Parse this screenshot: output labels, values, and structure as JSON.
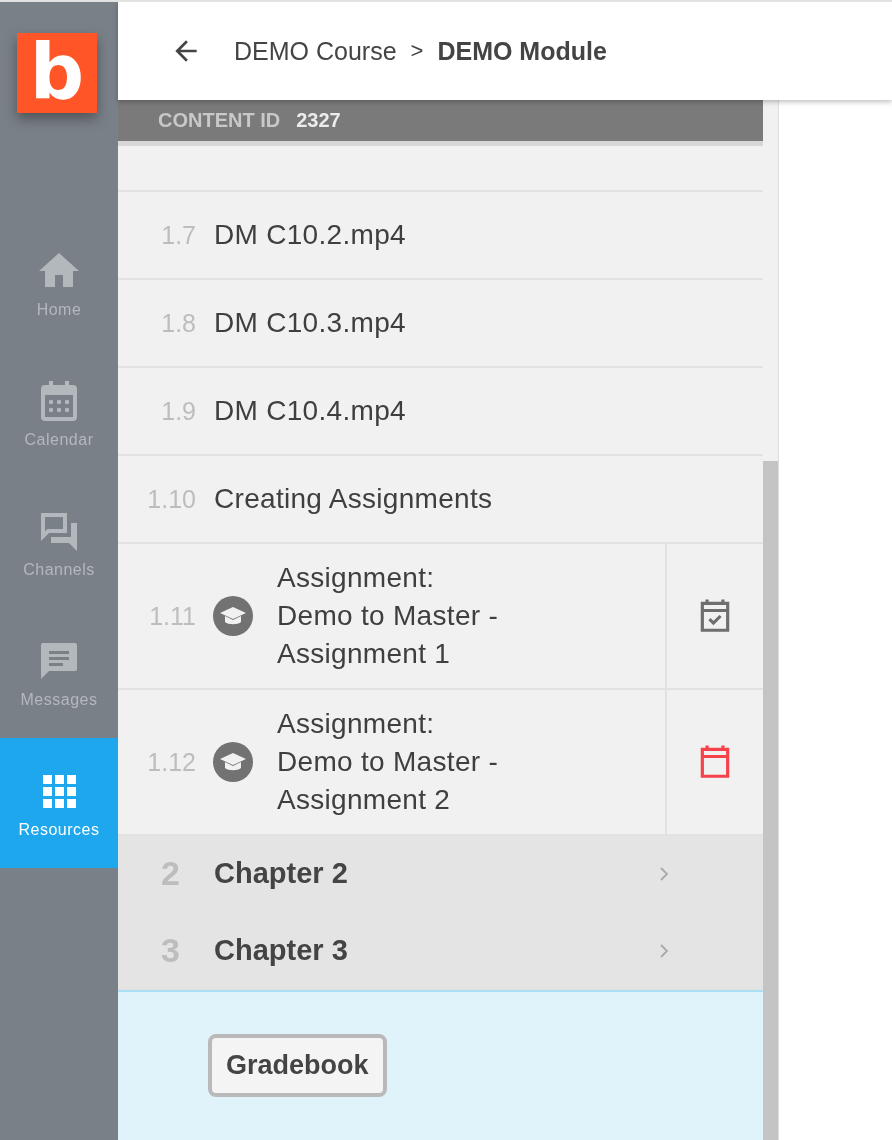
{
  "nav": {
    "logo": "b",
    "items": [
      {
        "label": "Home",
        "selected": false
      },
      {
        "label": "Calendar",
        "selected": false
      },
      {
        "label": "Channels",
        "selected": false
      },
      {
        "label": "Messages",
        "selected": false
      },
      {
        "label": "Resources",
        "selected": true
      }
    ]
  },
  "header": {
    "breadcrumb": [
      "DEMO Course",
      "DEMO Module"
    ],
    "separator": ">"
  },
  "content_id": {
    "label": "CONTENT ID",
    "value": "2327"
  },
  "items": [
    {
      "kind": "file",
      "number": "1.7",
      "title": "DM C10.2.mp4"
    },
    {
      "kind": "file",
      "number": "1.8",
      "title": "DM C10.3.mp4"
    },
    {
      "kind": "file",
      "number": "1.9",
      "title": "DM C10.4.mp4"
    },
    {
      "kind": "file",
      "number": "1.10",
      "title": "Creating Assignments"
    },
    {
      "kind": "assignment",
      "number": "1.11",
      "title": "Assignment:\nDemo to Master -\nAssignment 1",
      "submitted": true
    },
    {
      "kind": "assignment",
      "number": "1.12",
      "title": "Assignment:\nDemo to Master -\nAssignment 2",
      "submitted": false
    }
  ],
  "chapters": [
    {
      "number": "2",
      "title": "Chapter 2",
      "expanded": false
    },
    {
      "number": "3",
      "title": "Chapter 3",
      "expanded": false
    }
  ],
  "footer": {
    "button": "Gradebook"
  }
}
